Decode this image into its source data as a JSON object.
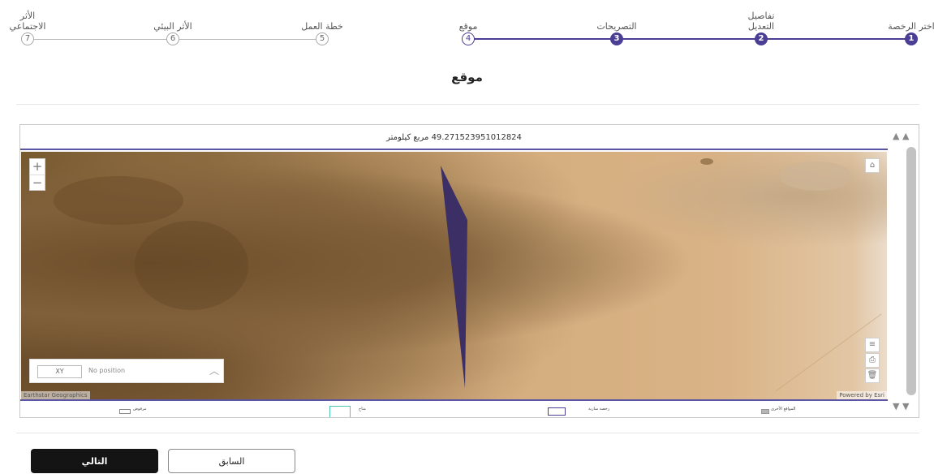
{
  "stepper": {
    "steps": [
      {
        "number": "1",
        "label": "اختر الرخصة",
        "state": "done"
      },
      {
        "number": "2",
        "label": "تفاصيل التعديل",
        "state": "done"
      },
      {
        "number": "3",
        "label": "التصريحات",
        "state": "done"
      },
      {
        "number": "4",
        "label": "موقع",
        "state": "current"
      },
      {
        "number": "5",
        "label": "خطة العمل",
        "state": "pending"
      },
      {
        "number": "6",
        "label": "الأثر البيئي",
        "state": "pending"
      },
      {
        "number": "7",
        "label": "الأثر الاجتماعي",
        "state": "pending"
      }
    ]
  },
  "section": {
    "title": "موقع"
  },
  "map": {
    "area_text": "49.271523951012824 مربع كيلومتر",
    "zoom_in": "+",
    "zoom_out": "−",
    "home_icon": "⌂",
    "layers_icon": "≡",
    "print_icon": "⎙",
    "delete_icon": "🗑",
    "xy_value": "XY",
    "position_text": "No position",
    "collapse_icon": "︿",
    "attribution_left": "Earthstar Geographics",
    "attribution_right": "Powered by Esri",
    "scroll_up_icon": "▲ ▲",
    "scroll_down_icon": "▼ ▼",
    "polygon_fill": "#3b2f66"
  },
  "legend": {
    "items": [
      {
        "label": "المواقع الأخرى",
        "swatch": "filled-gray"
      },
      {
        "label": "رخصة سارية",
        "swatch": "outline-purple"
      },
      {
        "label": "متاح",
        "swatch": "outline-teal"
      },
      {
        "label": "مرفوض",
        "swatch": "outline-gray"
      }
    ]
  },
  "actions": {
    "next_label": "التالي",
    "prev_label": "السابق"
  },
  "colors": {
    "primary": "#4b3f95",
    "button_dark": "#141414"
  }
}
